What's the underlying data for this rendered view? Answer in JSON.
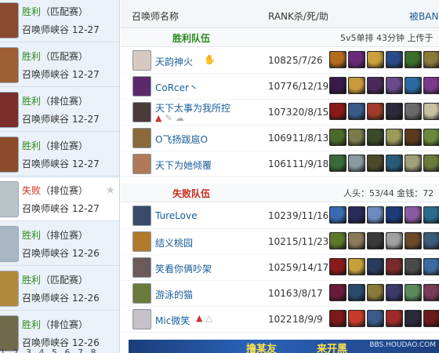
{
  "history": [
    {
      "result": "胜利",
      "result_type": "win",
      "mode": "（匹配赛）",
      "map": "召唤师峡谷",
      "date": "12-27",
      "avatar_color": "#8a4a2e"
    },
    {
      "result": "胜利",
      "result_type": "win",
      "mode": "（匹配赛）",
      "map": "召唤师峡谷",
      "date": "12-27",
      "avatar_color": "#9c5e32"
    },
    {
      "result": "胜利",
      "result_type": "win",
      "mode": "（排位赛）",
      "map": "召唤师峡谷",
      "date": "12-27",
      "avatar_color": "#7a2f2a"
    },
    {
      "result": "胜利",
      "result_type": "win",
      "mode": "（排位赛）",
      "map": "召唤师峡谷",
      "date": "12-27",
      "avatar_color": "#8d4b2a"
    },
    {
      "result": "失败",
      "result_type": "lose",
      "mode": "（排位赛）",
      "map": "召唤师峡谷",
      "date": "12-27",
      "avatar_color": "#b9c2c7",
      "selected": true
    },
    {
      "result": "胜利",
      "result_type": "win",
      "mode": "（排位赛）",
      "map": "召唤师峡谷",
      "date": "12-26",
      "avatar_color": "#a9b7c4"
    },
    {
      "result": "胜利",
      "result_type": "win",
      "mode": "（匹配赛）",
      "map": "召唤师峡谷",
      "date": "12-26",
      "avatar_color": "#b28a3c"
    },
    {
      "result": "胜利",
      "result_type": "win",
      "mode": "（排位赛）",
      "map": "召唤师峡谷",
      "date": "12-26",
      "avatar_color": "#6f6a4a"
    }
  ],
  "pager": "1 2 3 4 5 6 7 8",
  "header": {
    "summoner_col": "召唤师名称",
    "rank_col": "RANK杀/死/助",
    "ban_col": "被BAN"
  },
  "win_team": {
    "label": "胜利队伍",
    "info": "5v5单排 43分钟 上传于"
  },
  "lose_team": {
    "label": "失败队伍",
    "info": "人头：53/44 金钱：72"
  },
  "win_players": [
    {
      "name": "天韵神火",
      "rank": "1082",
      "kda": "5/7/26",
      "avatar_color": "#d8c9c0",
      "hand": "✋",
      "items": [
        "#b36b1e",
        "#6a2a7a",
        "#c8a13a",
        "#2a4b8a",
        "#3b6e2a",
        "#8a7a3a",
        "#2a2a2a"
      ]
    },
    {
      "name": "CoRcer丶",
      "rank": "1077",
      "kda": "6/12/19",
      "avatar_color": "#5a2a6a",
      "items": [
        "#3a1a4a",
        "#c89a3a",
        "#4a2a5a",
        "#6a4a8a",
        "#2a6aa0",
        "#7a3a8a",
        "#c8b04a"
      ]
    },
    {
      "name": "天下太事为我所控",
      "rank": "1073",
      "kda": "20/8/15",
      "avatar_color": "#4a3a3a",
      "badges": true,
      "items": [
        "#8a1a1a",
        "#3a5a8a",
        "#a03a2a",
        "#2a2a3a",
        "#6a6a6a",
        "#c8c0a0",
        "#8a2a2a"
      ]
    },
    {
      "name": "O飞扬跋扈O",
      "rank": "1069",
      "kda": "11/8/13",
      "avatar_color": "#8a6a3a",
      "items": [
        "#4a6a2a",
        "#7a7a4a",
        "#3a4a2a",
        "#9a9a5a",
        "#5a3a1a",
        "#6a8a3a",
        "#2a2a2a"
      ]
    },
    {
      "name": "天下为她倾覆",
      "rank": "1061",
      "kda": "11/9/18",
      "avatar_color": "#b07a5a",
      "items": [
        "#3a6a3a",
        "#8a9aa0",
        "#4a4a2a",
        "#2a5a7a",
        "#a0a07a",
        "#6a7a3a",
        "#c89a3a"
      ]
    }
  ],
  "lose_players": [
    {
      "name": "TureLove",
      "rank": "1023",
      "kda": "9/11/16",
      "avatar_color": "#3a4a6a",
      "items": [
        "#3a6ab0",
        "#2a2a5a",
        "#6a8ac0",
        "#1a3a7a",
        "#8a5aa0",
        "#2a6a8a",
        "#c8b04a"
      ]
    },
    {
      "name": "结义桃园",
      "rank": "1021",
      "kda": "5/11/23",
      "avatar_color": "#b07a2a",
      "items": [
        "#5a7a2a",
        "#8a7a5a",
        "#3a3a3a",
        "#a0a0a0",
        "#6a4a2a",
        "#3a5a7a",
        "#7a6a3a"
      ]
    },
    {
      "name": "笑看你俩吵架",
      "rank": "1025",
      "kda": "9/14/17",
      "avatar_color": "#6a5a5a",
      "items": [
        "#8a1a1a",
        "#c8a03a",
        "#2a3a5a",
        "#7a2a2a",
        "#4a4a4a",
        "#3a6aa0",
        "#b03a2a"
      ]
    },
    {
      "name": "游泳的猫",
      "rank": "1016",
      "kda": "3/8/17",
      "avatar_color": "#6a7a3a",
      "items": [
        "#6a1a3a",
        "#2a4a6a",
        "#8a7a3a",
        "#3a3a6a",
        "#5a8a5a",
        "#7a3a5a",
        "#2a2a2a"
      ]
    },
    {
      "name": "Mic微笑",
      "rank": "1022",
      "kda": "18/9/9",
      "avatar_color": "#c8c0c8",
      "badges2": true,
      "items": [
        "#7a1a1a",
        "#c83a2a",
        "#3a5a8a",
        "#a02a2a",
        "#2a2a3a",
        "#6a1a1a",
        "#c0a03a"
      ]
    }
  ],
  "banner": {
    "text1": "撸某友",
    "text2": "来开黑",
    "watermark": "BBS.HOUDAO.COM"
  }
}
